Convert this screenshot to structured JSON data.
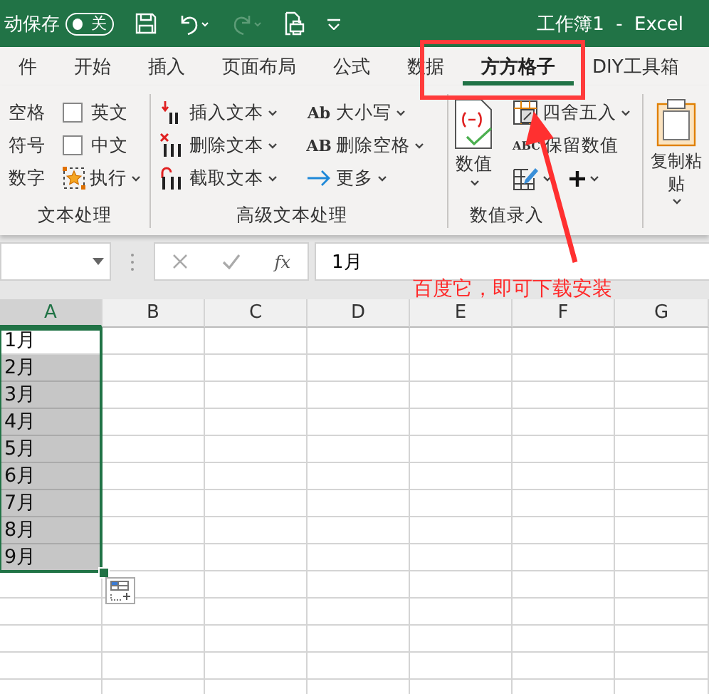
{
  "title_bar": {
    "autosave_label": "动保存",
    "autosave_toggle": {
      "label": "关",
      "on": false
    },
    "title": "工作簿1  -  Excel"
  },
  "tabs": [
    {
      "label": "件",
      "selected": false
    },
    {
      "label": "开始",
      "selected": false
    },
    {
      "label": "插入",
      "selected": false
    },
    {
      "label": "页面布局",
      "selected": false
    },
    {
      "label": "公式",
      "selected": false
    },
    {
      "label": "数据",
      "selected": false
    },
    {
      "label": "方方格子",
      "selected": true
    },
    {
      "label": "DIY工具箱",
      "selected": false
    }
  ],
  "ribbon": {
    "groups": [
      {
        "label": "文本处理",
        "columns": [
          [
            {
              "kind": "text",
              "label": "空格"
            },
            {
              "kind": "text",
              "label": "符号"
            },
            {
              "kind": "text",
              "label": "数字"
            }
          ],
          [
            {
              "kind": "checkbox",
              "label": "英文",
              "checked": false
            },
            {
              "kind": "checkbox",
              "label": "中文",
              "checked": false
            },
            {
              "kind": "menu",
              "label": "执行"
            }
          ]
        ]
      },
      {
        "label": "高级文本处理",
        "columns": [
          [
            {
              "kind": "menu",
              "label": "插入文本"
            },
            {
              "kind": "menu",
              "label": "删除文本"
            },
            {
              "kind": "menu",
              "label": "截取文本"
            }
          ],
          [
            {
              "kind": "menu",
              "label": "大小写",
              "icon_text": "Ab"
            },
            {
              "kind": "menu",
              "label": "删除空格",
              "icon_text": "AB"
            },
            {
              "kind": "menu",
              "label": "更多"
            }
          ]
        ]
      },
      {
        "label": "数值录入",
        "columns": [
          [
            {
              "kind": "large",
              "label": "数值"
            }
          ],
          [
            {
              "kind": "menu",
              "label": "四舍五入"
            },
            {
              "kind": "button",
              "label": "保留数值",
              "icon_text": "ABC"
            },
            {
              "kind": "icon-pair"
            }
          ]
        ]
      },
      {
        "columns": [
          [
            {
              "kind": "large",
              "label": "复制粘贴"
            }
          ]
        ]
      }
    ]
  },
  "formula_bar": {
    "fx_label": "fx",
    "value": "1月"
  },
  "sheet": {
    "columns": [
      {
        "label": "A",
        "selected": true
      },
      {
        "label": "B",
        "selected": false
      },
      {
        "label": "C",
        "selected": false
      },
      {
        "label": "D",
        "selected": false
      },
      {
        "label": "E",
        "selected": false
      },
      {
        "label": "F",
        "selected": false
      },
      {
        "label": "G",
        "selected": false
      }
    ],
    "column_a": [
      {
        "value": "1月",
        "selected": false
      },
      {
        "value": "2月",
        "selected": true
      },
      {
        "value": "3月",
        "selected": true
      },
      {
        "value": "4月",
        "selected": true
      },
      {
        "value": "5月",
        "selected": true
      },
      {
        "value": "6月",
        "selected": true
      },
      {
        "value": "7月",
        "selected": true
      },
      {
        "value": "8月",
        "selected": true
      },
      {
        "value": "9月",
        "selected": true
      }
    ]
  },
  "annotation": {
    "text": "百度它，即可下载安装"
  }
}
